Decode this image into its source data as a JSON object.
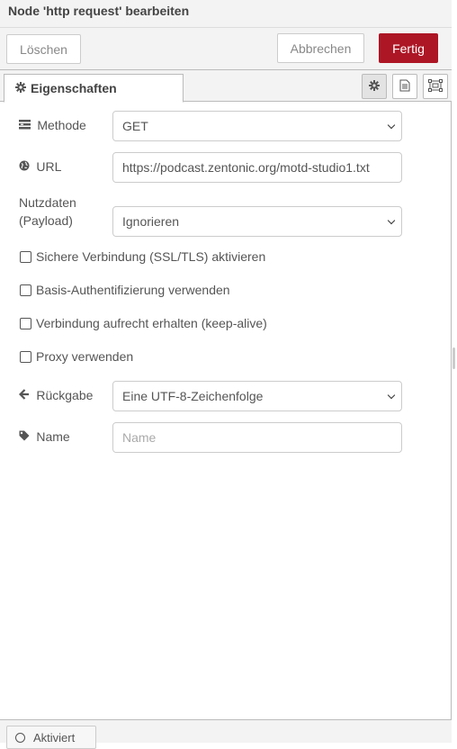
{
  "dialog": {
    "title": "Node 'http request' bearbeiten",
    "buttons": {
      "delete": "Löschen",
      "cancel": "Abbrechen",
      "done": "Fertig"
    },
    "accent": "#ad1625"
  },
  "tabs": [
    {
      "label": "Eigenschaften",
      "icon": "gear-icon"
    }
  ],
  "toolbar_icons": [
    "gear-icon",
    "description-icon",
    "appearance-icon"
  ],
  "form": {
    "method": {
      "label": "Methode",
      "icon": "list-icon",
      "value": "GET"
    },
    "url": {
      "label": "URL",
      "icon": "globe-icon",
      "value": "https://podcast.zentonic.org/motd-studio1.txt"
    },
    "payload": {
      "label_line1": "Nutzdaten",
      "label_line2": "(Payload)",
      "value": "Ignorieren"
    },
    "checkboxes": [
      {
        "label": "Sichere Verbindung (SSL/TLS) aktivieren",
        "checked": false
      },
      {
        "label": "Basis-Authentifizierung verwenden",
        "checked": false
      },
      {
        "label": "Verbindung aufrecht erhalten (keep-alive)",
        "checked": false
      },
      {
        "label": "Proxy verwenden",
        "checked": false
      }
    ],
    "return": {
      "label": "Rückgabe",
      "icon": "arrow-left-icon",
      "value": "Eine UTF-8-Zeichenfolge"
    },
    "name": {
      "label": "Name",
      "icon": "tag-icon",
      "value": "",
      "placeholder": "Name"
    }
  },
  "footer": {
    "toggle_label": "Aktiviert"
  }
}
